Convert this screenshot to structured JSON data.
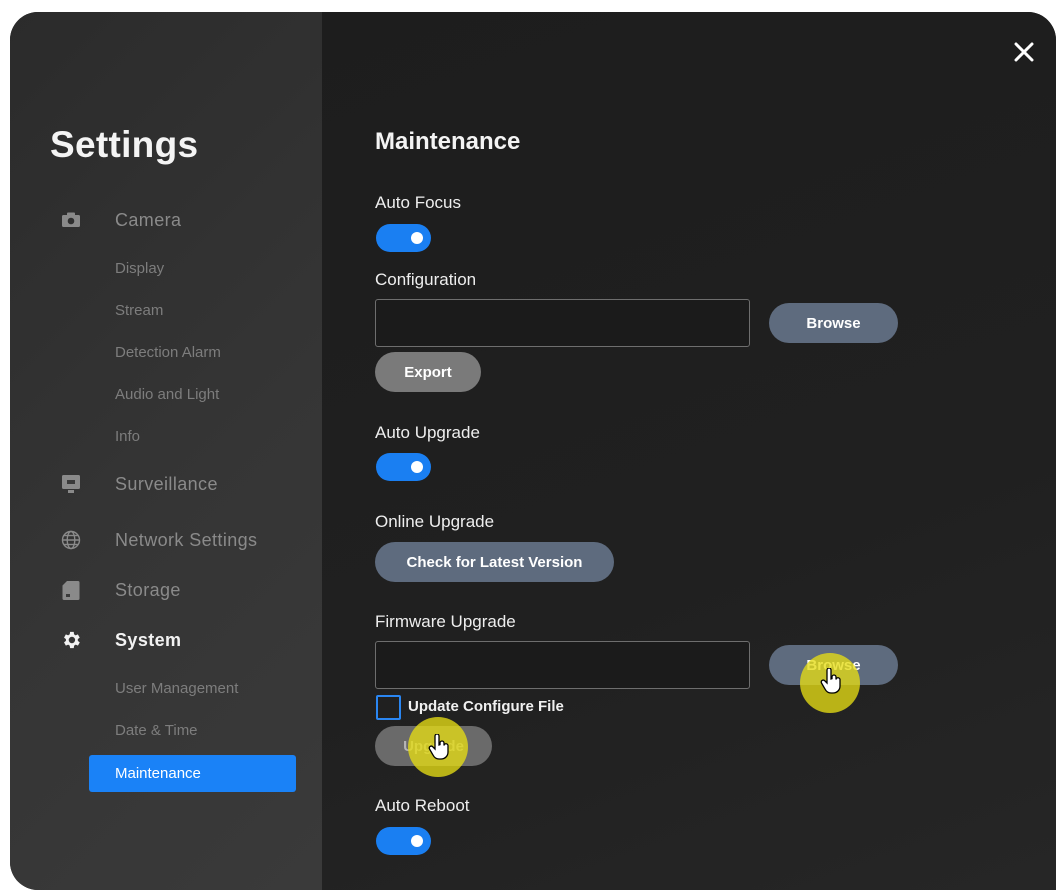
{
  "sidebar": {
    "title": "Settings",
    "groups": {
      "camera": {
        "label": "Camera",
        "icon": "camera-icon",
        "items": [
          "Display",
          "Stream",
          "Detection Alarm",
          "Audio and Light",
          "Info"
        ]
      },
      "surveillance": {
        "label": "Surveillance",
        "icon": "monitor-icon"
      },
      "network": {
        "label": "Network Settings",
        "icon": "globe-icon"
      },
      "storage": {
        "label": "Storage",
        "icon": "sd-card-icon"
      },
      "system": {
        "label": "System",
        "icon": "gear-icon",
        "items": [
          "User Management",
          "Date & Time",
          "Maintenance"
        ],
        "selected": "Maintenance"
      }
    }
  },
  "main": {
    "title": "Maintenance",
    "auto_focus": {
      "label": "Auto Focus",
      "enabled": true
    },
    "configuration": {
      "label": "Configuration",
      "value": "",
      "browse_label": "Browse",
      "export_label": "Export"
    },
    "auto_upgrade": {
      "label": "Auto Upgrade",
      "enabled": true
    },
    "online_upgrade": {
      "label": "Online Upgrade",
      "check_label": "Check for Latest Version"
    },
    "firmware_upgrade": {
      "label": "Firmware Upgrade",
      "value": "",
      "browse_label": "Browse",
      "update_config_label": "Update Configure File",
      "update_config_checked": false,
      "upgrade_label": "Upgrade"
    },
    "auto_reboot": {
      "label": "Auto Reboot",
      "enabled": true
    }
  },
  "colors": {
    "accent": "#1a82f7",
    "toggle_on": "#1a7ff2",
    "button_blue_gray": "#5e6b7e",
    "button_gray": "#7a7a7a",
    "click_highlight": "#e6dc14"
  }
}
